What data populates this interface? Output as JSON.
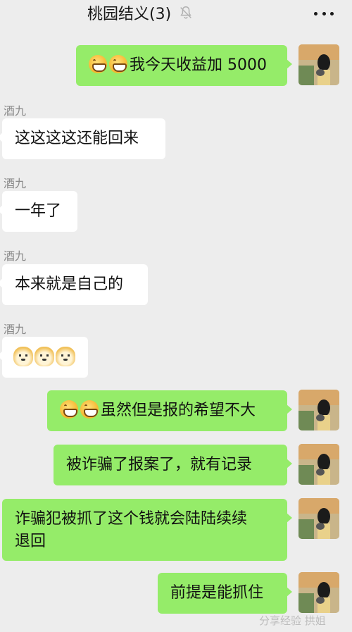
{
  "header": {
    "title": "桃园结义(3)",
    "mute_icon": "bell-off-icon",
    "more_icon": "more-dots-icon"
  },
  "messages": [
    {
      "side": "out",
      "emoji": "grin-emoji",
      "emoji_count": 2,
      "text": "我今天收益加 5000"
    },
    {
      "side": "in",
      "sender": "酒九",
      "text": "这这这这还能回来"
    },
    {
      "side": "in",
      "sender": "酒九",
      "text": "一年了"
    },
    {
      "side": "in",
      "sender": "酒九",
      "text": "本来就是自己的"
    },
    {
      "side": "in",
      "sender": "酒九",
      "emoji": "doge-emoji",
      "emoji_count": 3,
      "text": ""
    },
    {
      "side": "out",
      "emoji": "grin-emoji",
      "emoji_count": 2,
      "text": "虽然但是报的希望不大"
    },
    {
      "side": "out",
      "text": "被诈骗了报案了，就有记录"
    },
    {
      "side": "out",
      "text_line1": "诈骗犯被抓了这个钱就会陆陆续续",
      "text_line2": "退回"
    },
    {
      "side": "out",
      "text": "前提是能抓住"
    }
  ],
  "watermark": "分享经验 拱姐",
  "colors": {
    "background": "#ededed",
    "outgoing_bubble": "#95ec69",
    "incoming_bubble": "#ffffff"
  }
}
